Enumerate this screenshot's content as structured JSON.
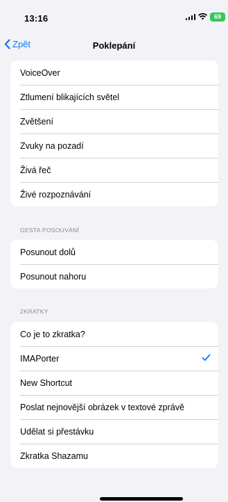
{
  "status_bar": {
    "time": "13:16",
    "battery": "69"
  },
  "nav": {
    "back_label": "Zpět",
    "title": "Poklepání"
  },
  "groups": [
    {
      "header": "",
      "items": [
        {
          "label": "VoiceOver"
        },
        {
          "label": "Ztlumení blikajících světel"
        },
        {
          "label": "Zvětšení"
        },
        {
          "label": "Zvuky na pozadí"
        },
        {
          "label": "Živá řeč"
        },
        {
          "label": "Živé rozpoznávání"
        }
      ]
    },
    {
      "header": "GESTA POSOUVÁNÍ",
      "items": [
        {
          "label": "Posunout dolů"
        },
        {
          "label": "Posunout nahoru"
        }
      ]
    },
    {
      "header": "ZKRATKY",
      "items": [
        {
          "label": "Co je to zkratka?"
        },
        {
          "label": "IMAPorter",
          "selected": true
        },
        {
          "label": "New Shortcut"
        },
        {
          "label": "Poslat nejnovější obrázek v textové zprávě"
        },
        {
          "label": "Udělat si přestávku"
        },
        {
          "label": "Zkratka Shazamu"
        }
      ]
    }
  ],
  "colors": {
    "accent": "#007aff",
    "battery": "#34c759",
    "background": "#f2f2f7"
  }
}
